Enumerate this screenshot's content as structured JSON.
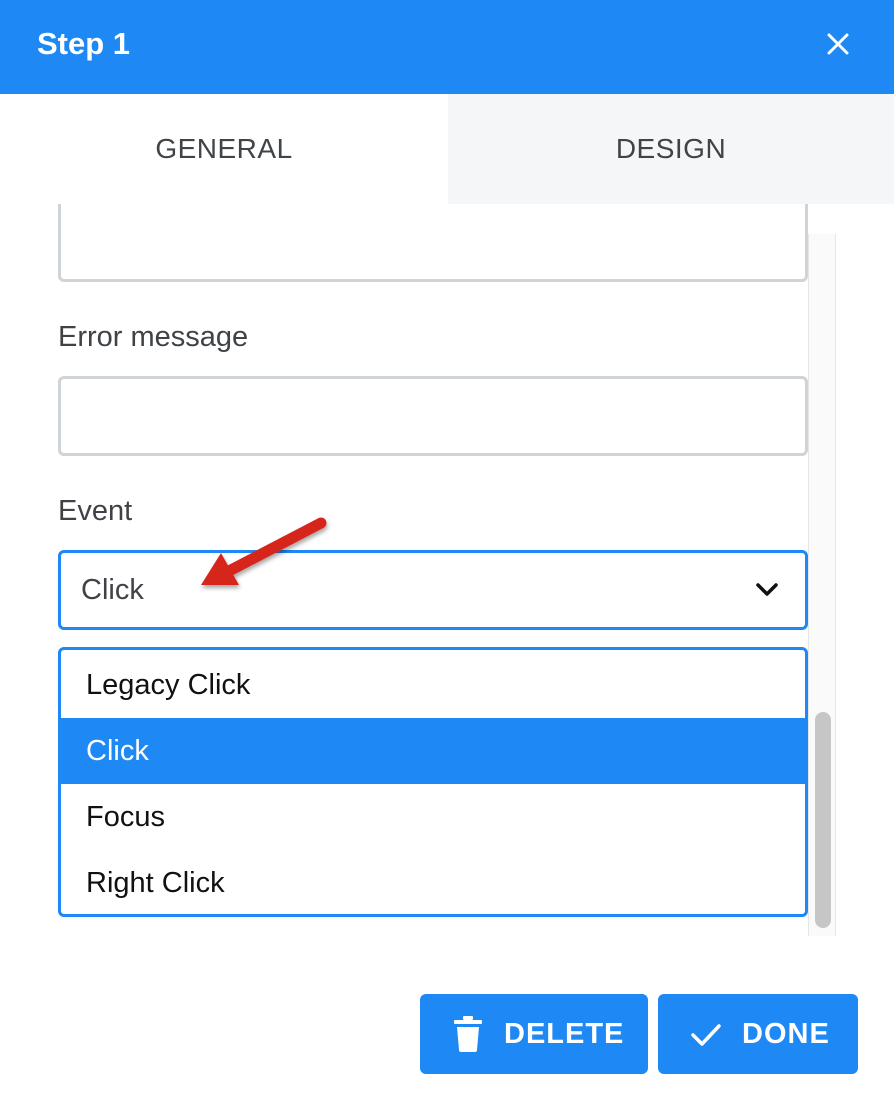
{
  "dialog": {
    "title": "Step 1"
  },
  "tabs": [
    {
      "label": "GENERAL"
    },
    {
      "label": "DESIGN"
    }
  ],
  "form": {
    "error_message_label": "Error message",
    "error_message_value": "",
    "event_label": "Event",
    "event_value": "Click",
    "event_options": [
      "Legacy Click",
      "Click",
      "Focus",
      "Right Click"
    ],
    "selected_option": "Click"
  },
  "footer": {
    "delete_label": "DELETE",
    "done_label": "DONE"
  },
  "colors": {
    "accent": "#1e88f5",
    "annotation_arrow": "#d6261f"
  },
  "icons": {
    "close": "close-icon",
    "chevron": "chevron-down-icon",
    "delete": "trash-icon",
    "done": "check-icon"
  }
}
